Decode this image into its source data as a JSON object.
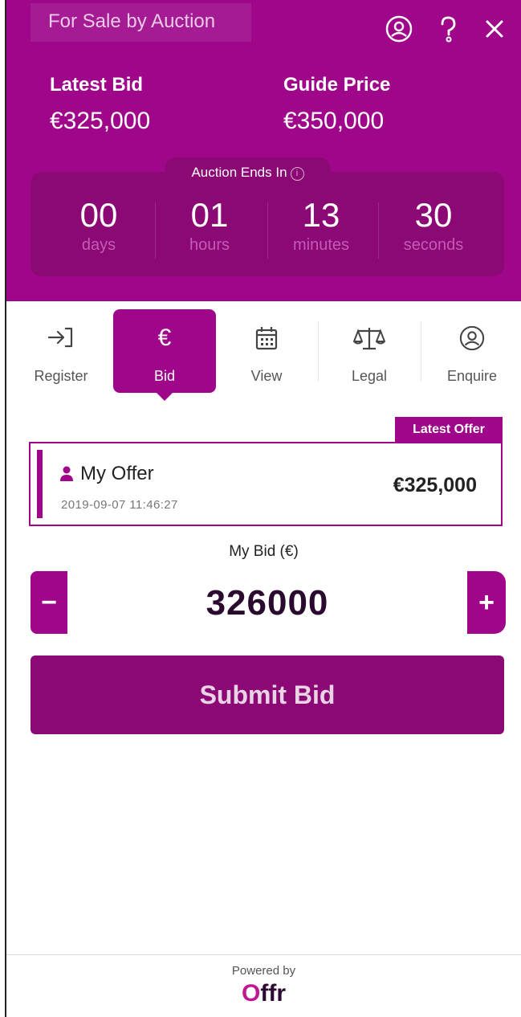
{
  "header": {
    "sale_type": "For Sale by Auction",
    "latest_bid_label": "Latest Bid",
    "latest_bid_value": "€325,000",
    "guide_price_label": "Guide Price",
    "guide_price_value": "€350,000",
    "icons": [
      "user-icon",
      "help-icon",
      "close-icon"
    ]
  },
  "countdown": {
    "title": "Auction Ends In",
    "info_glyph": "i",
    "units": [
      {
        "value": "00",
        "label": "days"
      },
      {
        "value": "01",
        "label": "hours"
      },
      {
        "value": "13",
        "label": "minutes"
      },
      {
        "value": "30",
        "label": "seconds"
      }
    ]
  },
  "tabs": [
    {
      "label": "Register",
      "icon": "sign-in-icon"
    },
    {
      "label": "Bid",
      "icon": "euro-icon",
      "glyph": "€"
    },
    {
      "label": "View",
      "icon": "calendar-icon"
    },
    {
      "label": "Legal",
      "icon": "scales-icon"
    },
    {
      "label": "Enquire",
      "icon": "user-icon"
    }
  ],
  "active_tab": "Bid",
  "latest_offer": {
    "badge": "Latest Offer",
    "title": "My Offer",
    "datetime": "2019-09-07 11:46:27",
    "amount": "€325,000"
  },
  "bid": {
    "label": "My Bid (€)",
    "value": "326000",
    "minus": "−",
    "plus": "+",
    "submit_label": "Submit Bid"
  },
  "footer": {
    "powered_by": "Powered by",
    "logo_o": "O",
    "logo_rest": "ffr"
  },
  "colors": {
    "brand": "#a0068a",
    "brand_dark": "#8b0875",
    "text_dark": "#2a0a2e"
  }
}
